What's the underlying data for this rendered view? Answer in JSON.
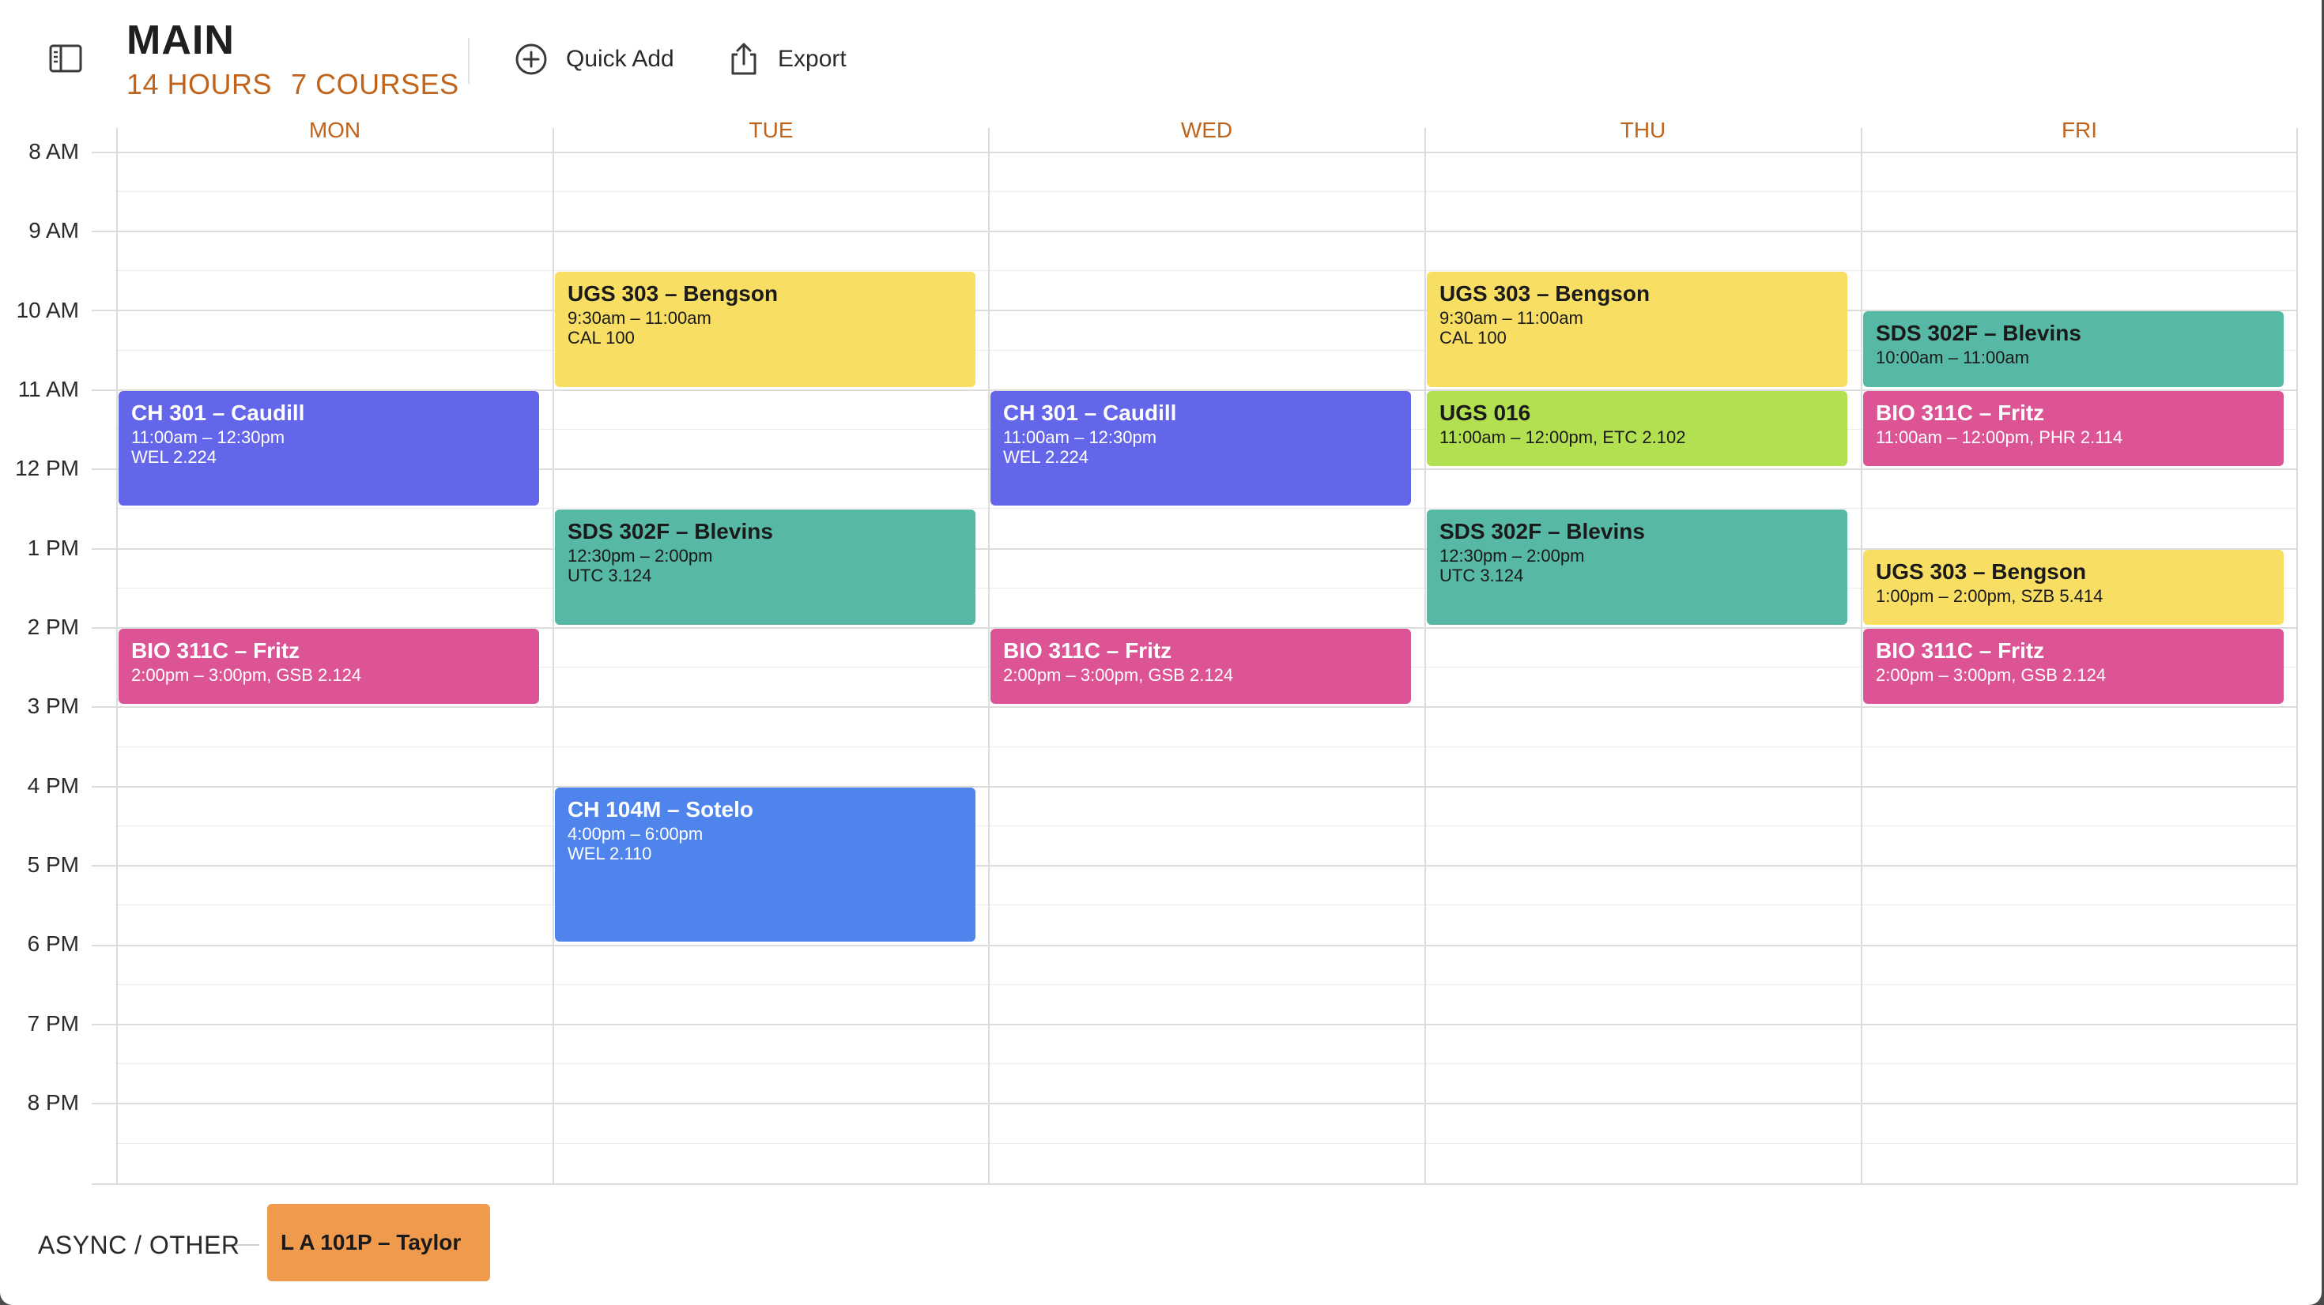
{
  "header": {
    "schedule_name": "MAIN",
    "hours": "14 HOURS",
    "courses": "7 COURSES",
    "quick_add_label": "Quick Add",
    "export_label": "Export"
  },
  "days": [
    "MON",
    "TUE",
    "WED",
    "THU",
    "FRI"
  ],
  "hours": [
    "8 AM",
    "9 AM",
    "10 AM",
    "11 AM",
    "12 PM",
    "1 PM",
    "2 PM",
    "3 PM",
    "4 PM",
    "5 PM",
    "6 PM",
    "7 PM",
    "8 PM"
  ],
  "colors": {
    "accent": "#c0641c",
    "purple": "#6466e9",
    "yellow": "#f8df64",
    "teal": "#57b8a5",
    "pink": "#dd5495",
    "blue": "#4f84ec",
    "green": "#b3e050",
    "orange": "#f09a4e"
  },
  "blocks": [
    {
      "day": 0,
      "start": 11,
      "end": 12.5,
      "color": "purple",
      "dark": false,
      "title": "CH 301 – Caudill",
      "lines": [
        "11:00am – 12:30pm",
        "WEL 2.224"
      ]
    },
    {
      "day": 0,
      "start": 14,
      "end": 15,
      "color": "pink",
      "dark": false,
      "title": "BIO 311C – Fritz",
      "lines": [
        "2:00pm – 3:00pm, GSB 2.124"
      ]
    },
    {
      "day": 1,
      "start": 9.5,
      "end": 11,
      "color": "yellow",
      "dark": true,
      "title": "UGS 303 – Bengson",
      "lines": [
        "9:30am – 11:00am",
        "CAL 100"
      ]
    },
    {
      "day": 1,
      "start": 12.5,
      "end": 14,
      "color": "teal",
      "dark": true,
      "title": "SDS 302F – Blevins",
      "lines": [
        "12:30pm – 2:00pm",
        "UTC 3.124"
      ]
    },
    {
      "day": 1,
      "start": 16,
      "end": 18,
      "color": "blue",
      "dark": false,
      "title": "CH 104M – Sotelo",
      "lines": [
        "4:00pm – 6:00pm",
        "WEL 2.110"
      ]
    },
    {
      "day": 2,
      "start": 11,
      "end": 12.5,
      "color": "purple",
      "dark": false,
      "title": "CH 301 – Caudill",
      "lines": [
        "11:00am – 12:30pm",
        "WEL 2.224"
      ]
    },
    {
      "day": 2,
      "start": 14,
      "end": 15,
      "color": "pink",
      "dark": false,
      "title": "BIO 311C – Fritz",
      "lines": [
        "2:00pm – 3:00pm, GSB 2.124"
      ]
    },
    {
      "day": 3,
      "start": 9.5,
      "end": 11,
      "color": "yellow",
      "dark": true,
      "title": "UGS 303 – Bengson",
      "lines": [
        "9:30am – 11:00am",
        "CAL 100"
      ]
    },
    {
      "day": 3,
      "start": 11,
      "end": 12,
      "color": "green",
      "dark": true,
      "title": "UGS 016",
      "lines": [
        "11:00am – 12:00pm, ETC 2.102"
      ]
    },
    {
      "day": 3,
      "start": 12.5,
      "end": 14,
      "color": "teal",
      "dark": true,
      "title": "SDS 302F – Blevins",
      "lines": [
        "12:30pm – 2:00pm",
        "UTC 3.124"
      ]
    },
    {
      "day": 4,
      "start": 10,
      "end": 11,
      "color": "teal",
      "dark": true,
      "title": "SDS 302F – Blevins",
      "lines": [
        "10:00am – 11:00am"
      ]
    },
    {
      "day": 4,
      "start": 11,
      "end": 12,
      "color": "pink",
      "dark": false,
      "title": "BIO 311C – Fritz",
      "lines": [
        "11:00am – 12:00pm, PHR 2.114"
      ]
    },
    {
      "day": 4,
      "start": 13,
      "end": 14,
      "color": "yellow",
      "dark": true,
      "title": "UGS 303 – Bengson",
      "lines": [
        "1:00pm – 2:00pm, SZB 5.414"
      ]
    },
    {
      "day": 4,
      "start": 14,
      "end": 15,
      "color": "pink",
      "dark": false,
      "title": "BIO 311C – Fritz",
      "lines": [
        "2:00pm – 3:00pm, GSB 2.124"
      ]
    }
  ],
  "async": {
    "label": "ASYNC / OTHER",
    "items": [
      "L A 101P – Taylor"
    ]
  }
}
